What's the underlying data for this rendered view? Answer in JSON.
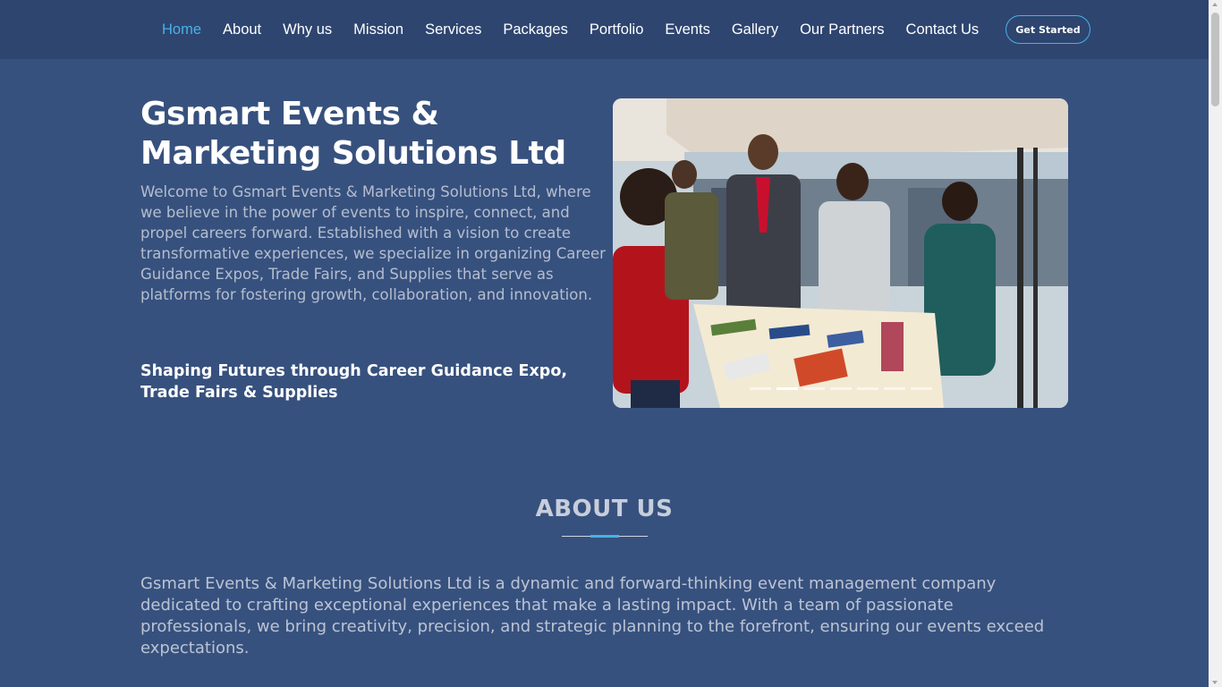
{
  "colors": {
    "background": "#37517e",
    "header_background": "#2e4570",
    "accent": "#47b2e4",
    "text": "#ffffff"
  },
  "nav": {
    "items": [
      {
        "label": "Home",
        "active": true
      },
      {
        "label": "About"
      },
      {
        "label": "Why us"
      },
      {
        "label": "Mission"
      },
      {
        "label": "Services"
      },
      {
        "label": "Packages"
      },
      {
        "label": "Portfolio"
      },
      {
        "label": "Events"
      },
      {
        "label": "Gallery"
      },
      {
        "label": "Our Partners"
      },
      {
        "label": "Contact Us"
      }
    ],
    "cta_label": "Get Started"
  },
  "hero": {
    "title": "Gsmart Events & Marketing Solutions Ltd",
    "description": "Welcome to Gsmart Events & Marketing Solutions Ltd, where we believe in the power of events to inspire, connect, and propel careers forward. Established with a vision to create transformative experiences, we specialize in organizing Career Guidance Expos, Trade Fairs, and Supplies that serve as platforms for fostering growth, collaboration, and innovation.",
    "tagline": "Shaping Futures through Career Guidance Expo, Trade Fairs & Supplies",
    "carousel": {
      "slide_count": 7,
      "active_index": 1,
      "image_description": "event-photo"
    }
  },
  "about": {
    "title": "ABOUT US",
    "text": "Gsmart Events & Marketing Solutions Ltd is a dynamic and forward-thinking event management company dedicated to crafting exceptional experiences that make a lasting impact. With a team of passionate professionals, we bring creativity, precision, and strategic planning to the forefront, ensuring our events exceed expectations."
  }
}
